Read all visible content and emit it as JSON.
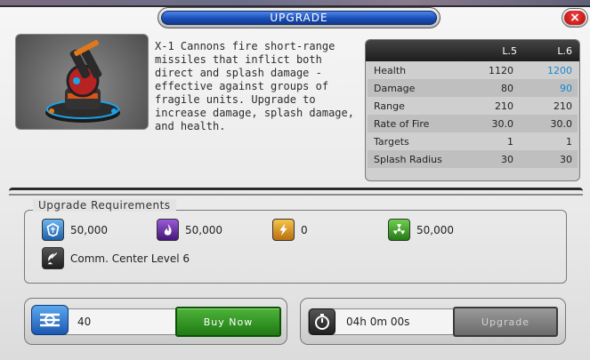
{
  "header": {
    "title": "UPGRADE",
    "close_label": "×"
  },
  "unit": {
    "description": "X-1 Cannons fire short-range missiles that inflict both direct and splash damage - effective against groups of fragile units. Upgrade to increase damage, splash damage, and health."
  },
  "stats": {
    "col_l5": "L.5",
    "col_l6": "L.6",
    "rows": [
      {
        "label": "Health",
        "l5": "1120",
        "l6": "1200",
        "improved": true
      },
      {
        "label": "Damage",
        "l5": "80",
        "l6": "90",
        "improved": true
      },
      {
        "label": "Range",
        "l5": "210",
        "l6": "210",
        "improved": false
      },
      {
        "label": "Rate of Fire",
        "l5": "30.0",
        "l6": "30.0",
        "improved": false
      },
      {
        "label": "Targets",
        "l5": "1",
        "l6": "1",
        "improved": false
      },
      {
        "label": "Splash Radius",
        "l5": "30",
        "l6": "30",
        "improved": false
      }
    ]
  },
  "requirements": {
    "title": "Upgrade Requirements",
    "resources": [
      {
        "icon": "shield-crystal-icon",
        "value": "50,000",
        "color": "#3d8fd6"
      },
      {
        "icon": "purple-flame-icon",
        "value": "50,000",
        "color": "#6a2aa8"
      },
      {
        "icon": "lightning-icon",
        "value": "0",
        "color": "#e0a020"
      },
      {
        "icon": "radiation-icon",
        "value": "50,000",
        "color": "#3c9a2a"
      }
    ],
    "building": {
      "icon": "satellite-dish-icon",
      "label": "Comm. Center Level 6"
    }
  },
  "buy": {
    "amount": "40",
    "button_label": "Buy Now",
    "icon": "currency-icon"
  },
  "timer": {
    "duration": "04h 0m 00s",
    "button_label": "Upgrade",
    "icon": "timer-icon"
  },
  "colors": {
    "accent": "#1b4fb8",
    "improved": "#1788d0",
    "buy": "#2f9a22"
  }
}
